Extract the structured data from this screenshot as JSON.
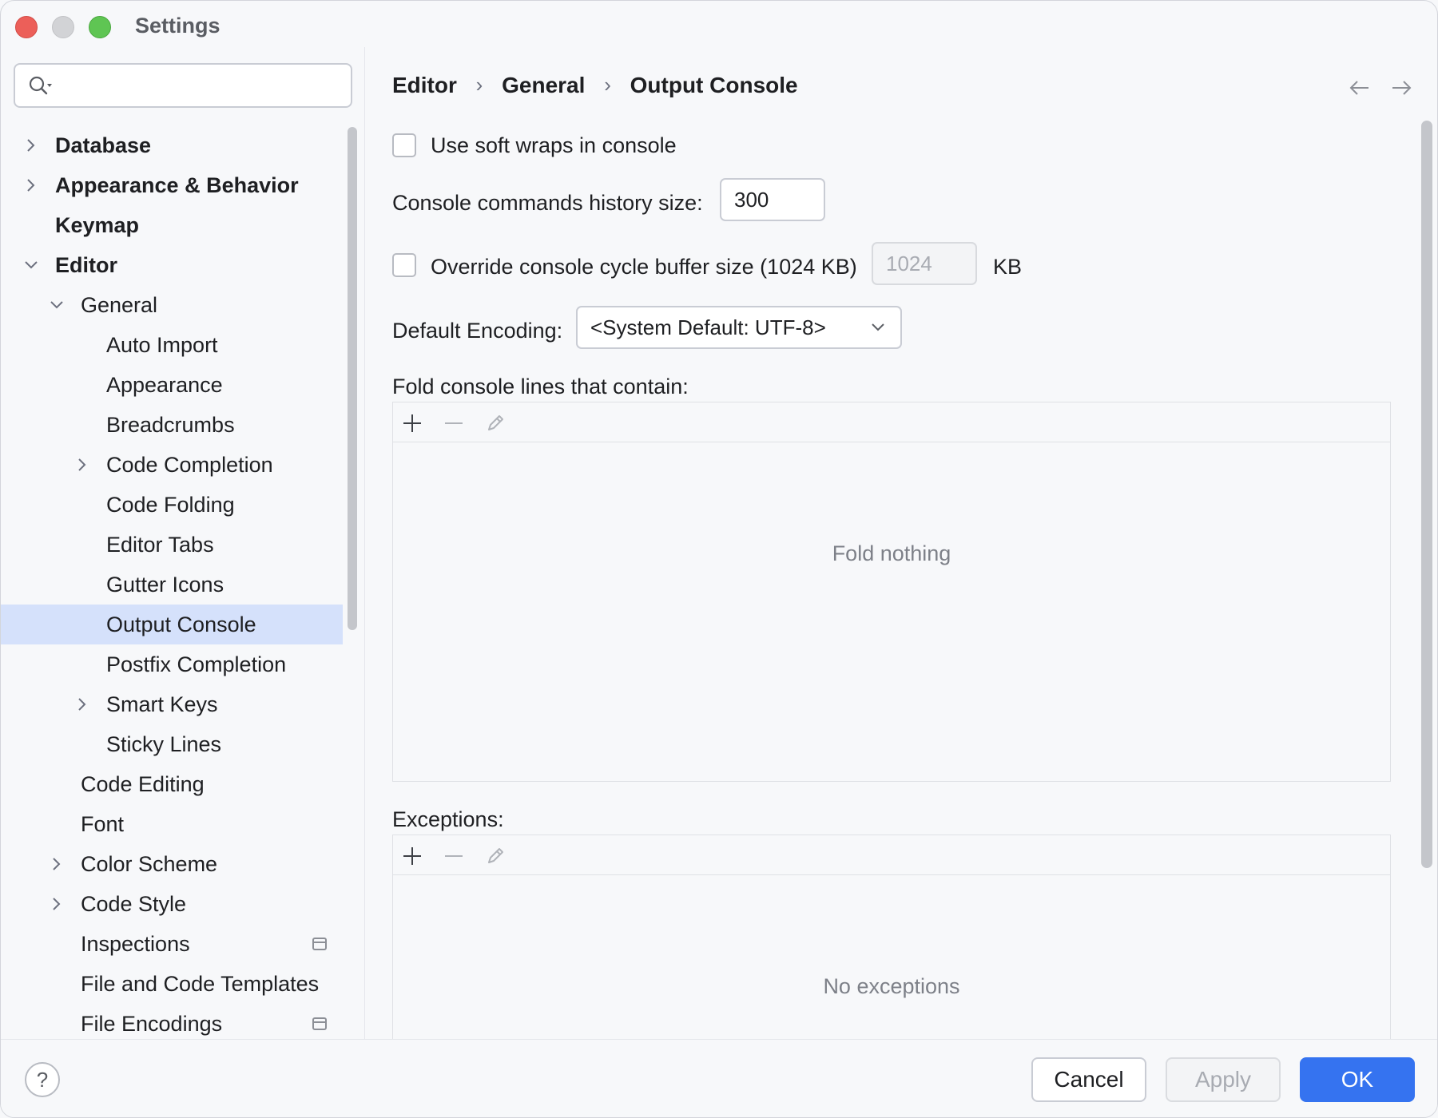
{
  "window": {
    "title": "Settings"
  },
  "search": {
    "placeholder": ""
  },
  "sidebar": {
    "items": [
      {
        "label": "Database",
        "level": 0,
        "expandable": true,
        "expanded": false,
        "bold": true
      },
      {
        "label": "Appearance & Behavior",
        "level": 0,
        "expandable": true,
        "expanded": false,
        "bold": true
      },
      {
        "label": "Keymap",
        "level": 0,
        "expandable": false,
        "bold": true
      },
      {
        "label": "Editor",
        "level": 0,
        "expandable": true,
        "expanded": true,
        "bold": true
      },
      {
        "label": "General",
        "level": 1,
        "expandable": true,
        "expanded": true
      },
      {
        "label": "Auto Import",
        "level": 2
      },
      {
        "label": "Appearance",
        "level": 2
      },
      {
        "label": "Breadcrumbs",
        "level": 2
      },
      {
        "label": "Code Completion",
        "level": 2,
        "expandable": true,
        "expanded": false
      },
      {
        "label": "Code Folding",
        "level": 2
      },
      {
        "label": "Editor Tabs",
        "level": 2
      },
      {
        "label": "Gutter Icons",
        "level": 2
      },
      {
        "label": "Output Console",
        "level": 2,
        "selected": true
      },
      {
        "label": "Postfix Completion",
        "level": 2
      },
      {
        "label": "Smart Keys",
        "level": 2,
        "expandable": true,
        "expanded": false
      },
      {
        "label": "Sticky Lines",
        "level": 2
      },
      {
        "label": "Code Editing",
        "level": 1
      },
      {
        "label": "Font",
        "level": 1
      },
      {
        "label": "Color Scheme",
        "level": 1,
        "expandable": true,
        "expanded": false
      },
      {
        "label": "Code Style",
        "level": 1,
        "expandable": true,
        "expanded": false
      },
      {
        "label": "Inspections",
        "level": 1,
        "project_icon": true
      },
      {
        "label": "File and Code Templates",
        "level": 1
      },
      {
        "label": "File Encodings",
        "level": 1,
        "project_icon": true
      }
    ]
  },
  "breadcrumb": {
    "items": [
      "Editor",
      "General",
      "Output Console"
    ],
    "separator": "›"
  },
  "settings": {
    "soft_wraps_label": "Use soft wraps in console",
    "soft_wraps_checked": false,
    "history_label": "Console commands history size:",
    "history_value": "300",
    "override_label": "Override console cycle buffer size (1024 KB)",
    "override_checked": false,
    "buffer_value": "1024",
    "buffer_unit": "KB",
    "encoding_label": "Default Encoding:",
    "encoding_value": "<System Default: UTF-8>",
    "fold_label": "Fold console lines that contain:",
    "fold_empty": "Fold nothing",
    "exceptions_label": "Exceptions:",
    "exceptions_empty": "No exceptions"
  },
  "footer": {
    "help": "?",
    "cancel": "Cancel",
    "apply": "Apply",
    "ok": "OK"
  },
  "colors": {
    "accent": "#3573f0",
    "selection": "#d5e1fb",
    "background": "#f7f8fa"
  }
}
